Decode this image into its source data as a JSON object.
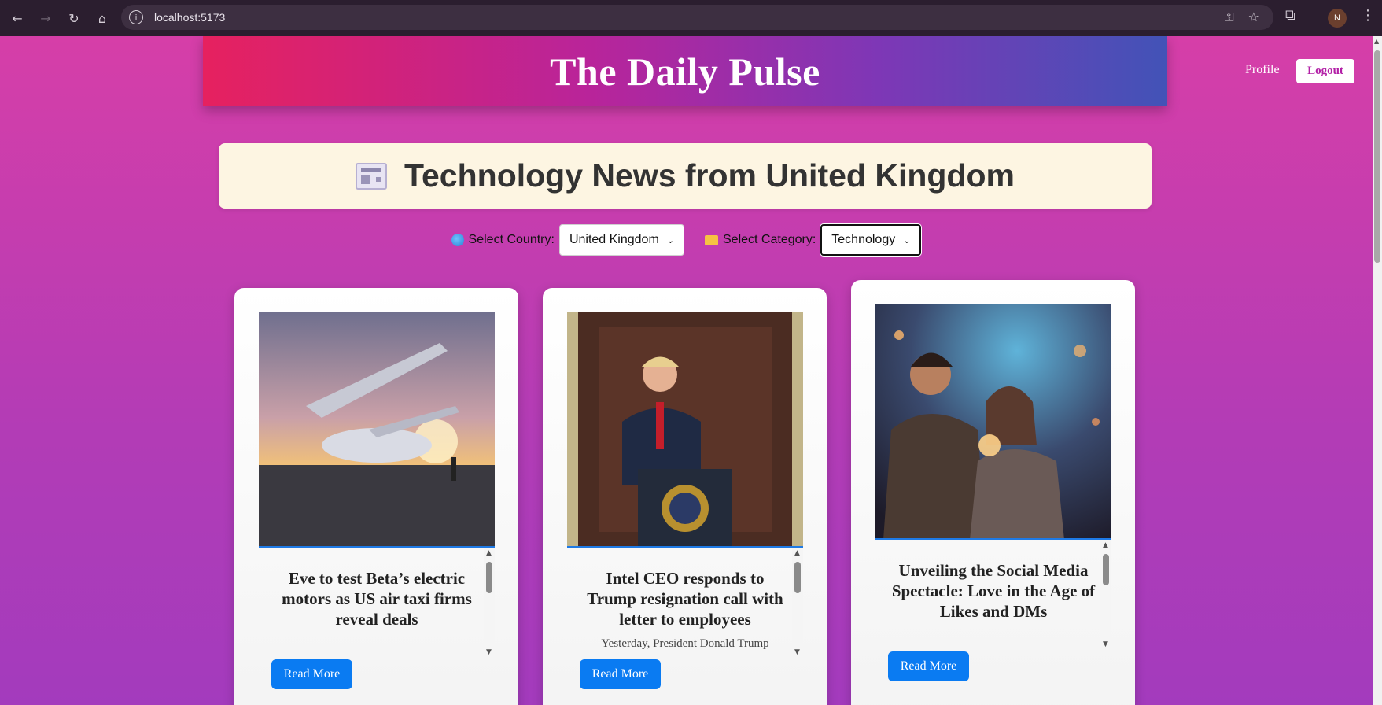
{
  "browser": {
    "url": "localhost:5173",
    "profile_initial": "N"
  },
  "header": {
    "site_title": "The Daily Pulse",
    "profile_label": "Profile",
    "logout_label": "Logout"
  },
  "main": {
    "heading": "Technology News from United Kingdom",
    "country_label": "Select Country:",
    "country_value": "United Kingdom",
    "category_label": "Select Category:",
    "category_value": "Technology"
  },
  "articles": [
    {
      "title": "Eve to test Beta’s electric motors as US air taxi firms reveal deals",
      "description": "",
      "read_more": "Read More",
      "image_icon": "air-taxi-image"
    },
    {
      "title": "Intel CEO responds to Trump resignation call with letter to employees",
      "description": "Yesterday, President Donald Trump",
      "read_more": "Read More",
      "image_icon": "president-podium-image"
    },
    {
      "title": "Unveiling the Social Media Spectacle: Love in the Age of Likes and DMs",
      "description": "",
      "read_more": "Read More",
      "image_icon": "couple-phone-image"
    }
  ],
  "colors": {
    "banner_start": "#e6215f",
    "banner_end": "#4253b7",
    "button_blue": "#0a7bf2",
    "heading_bg": "#fdf5e2"
  }
}
